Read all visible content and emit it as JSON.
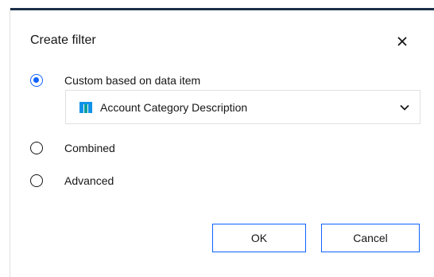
{
  "dialog": {
    "title": "Create filter",
    "close_icon": "close-icon"
  },
  "options": [
    {
      "label": "Custom based on data item",
      "selected": true
    },
    {
      "label": "Combined",
      "selected": false
    },
    {
      "label": "Advanced",
      "selected": false
    }
  ],
  "data_item_select": {
    "value": "Account Category Description",
    "icon": "table-column-icon",
    "icon_colors": [
      "#1192e8",
      "#009d9a"
    ],
    "chevron_icon": "chevron-down-icon"
  },
  "buttons": {
    "ok_label": "OK",
    "cancel_label": "Cancel"
  },
  "colors": {
    "accent": "#0f62fe",
    "header_bar": "#1d3049"
  }
}
